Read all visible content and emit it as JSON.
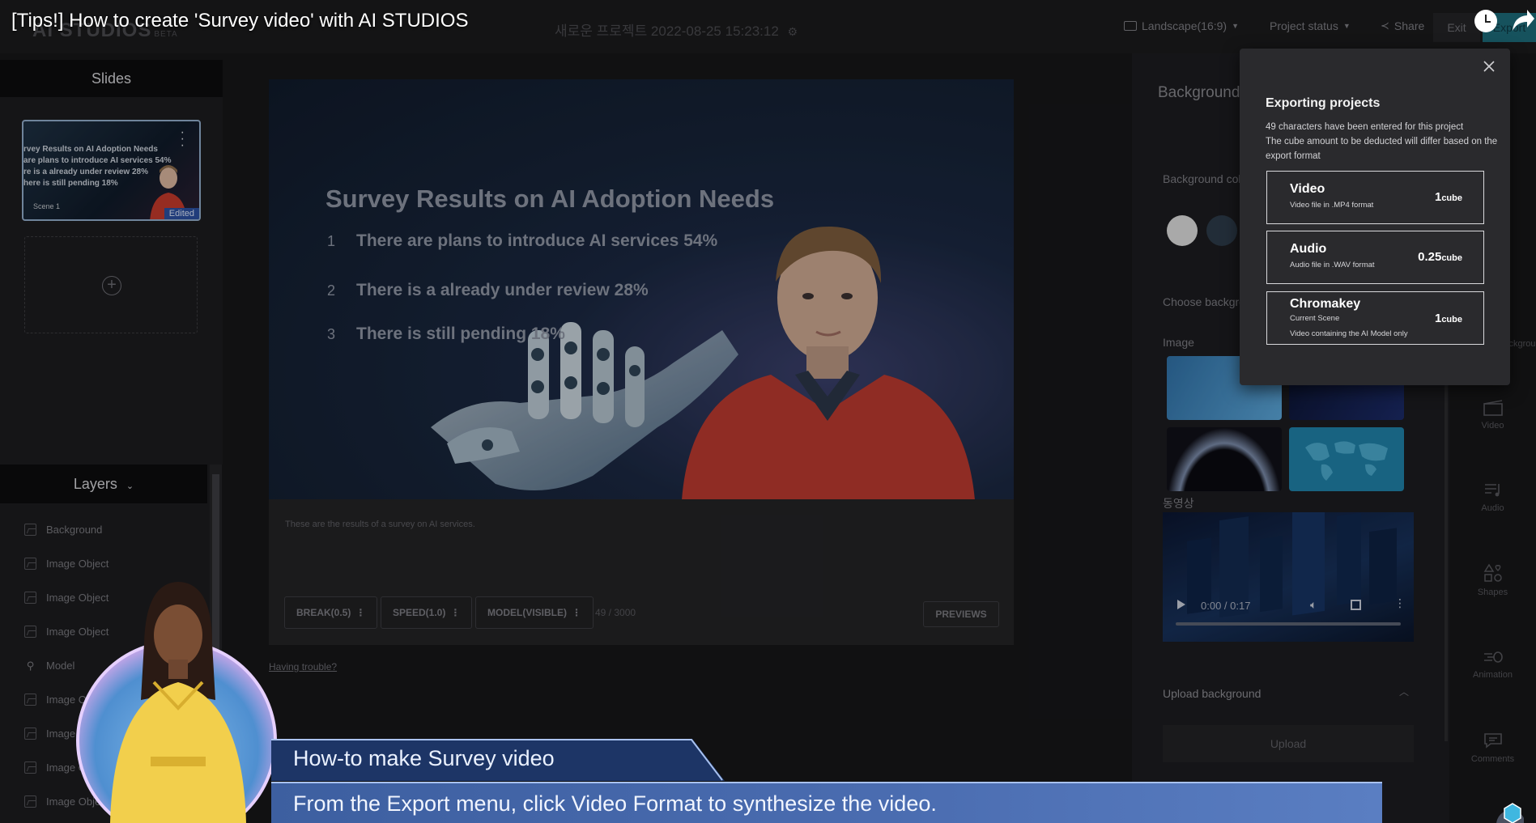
{
  "video_overlay": {
    "title": "[Tips!] How to create 'Survey video' with AI STUDIOS",
    "banner_heading": "How-to make Survey video",
    "banner_caption": "From the Export menu, click Video Format to synthesize the video."
  },
  "topbar": {
    "logo": "AI STUDIOS",
    "logo_badge": "BETA",
    "project_name": "새로운 프로젝트 2022-08-25 15:23:12",
    "orientation": "Landscape(16:9)",
    "project_status": "Project status",
    "share": "Share",
    "exit": "Exit",
    "export": "Export"
  },
  "slides": {
    "header": "Slides",
    "items": [
      {
        "thumb_lines": [
          "rvey Results on AI Adoption Needs",
          "are plans to introduce AI services 54%",
          "re is a already under review 28%",
          "here is still pending 18%"
        ],
        "scene": "Scene 1",
        "badge": "Edited"
      }
    ]
  },
  "layers": {
    "header": "Layers",
    "items": [
      "Background",
      "Image Object",
      "Image Object",
      "Image Object",
      "Model",
      "Image Object",
      "Image Object",
      "Image Object",
      "Image Object"
    ]
  },
  "canvas": {
    "title": "Survey Results on AI Adoption Needs",
    "items": [
      {
        "num": "1",
        "text": "There are plans to introduce AI services 54%"
      },
      {
        "num": "2",
        "text": "There is a already under review 28%"
      },
      {
        "num": "3",
        "text": "There is still pending 18%"
      }
    ]
  },
  "script": {
    "text": "These are the results of a survey on AI services.",
    "break": "BREAK(0.5)",
    "speed": "SPEED(1.0)",
    "model": "MODEL(VISIBLE)",
    "char_count": "49 / 3000",
    "preview": "PREVIEWS",
    "trouble": "Having trouble?"
  },
  "background_panel": {
    "title": "Background",
    "color_label": "Background color",
    "choose_label": "Choose background",
    "image_label": "Image",
    "video_label": "동영상",
    "video_time": "0:00 / 0:17",
    "upload_label": "Upload background",
    "upload_button": "Upload",
    "swatch_colors": [
      "#d9d9d9",
      "#2c3a48"
    ]
  },
  "rail": {
    "items": [
      "Background",
      "Video",
      "Audio",
      "Shapes",
      "Animation",
      "Comments"
    ]
  },
  "export_popup": {
    "title": "Exporting projects",
    "desc_lines": [
      "49 characters have been entered for this project",
      "The cube amount to be deducted will differ based on the export format"
    ],
    "formats": [
      {
        "name": "Video",
        "desc": "Video file in .MP4 format",
        "cost": "1",
        "unit": "cube"
      },
      {
        "name": "Audio",
        "desc": "Audio file in .WAV format",
        "cost": "0.25",
        "unit": "cube"
      },
      {
        "name": "Chromakey",
        "desc": "Current Scene",
        "desc2": "Video containing the AI Model only",
        "cost": "1",
        "unit": "cube"
      }
    ]
  }
}
